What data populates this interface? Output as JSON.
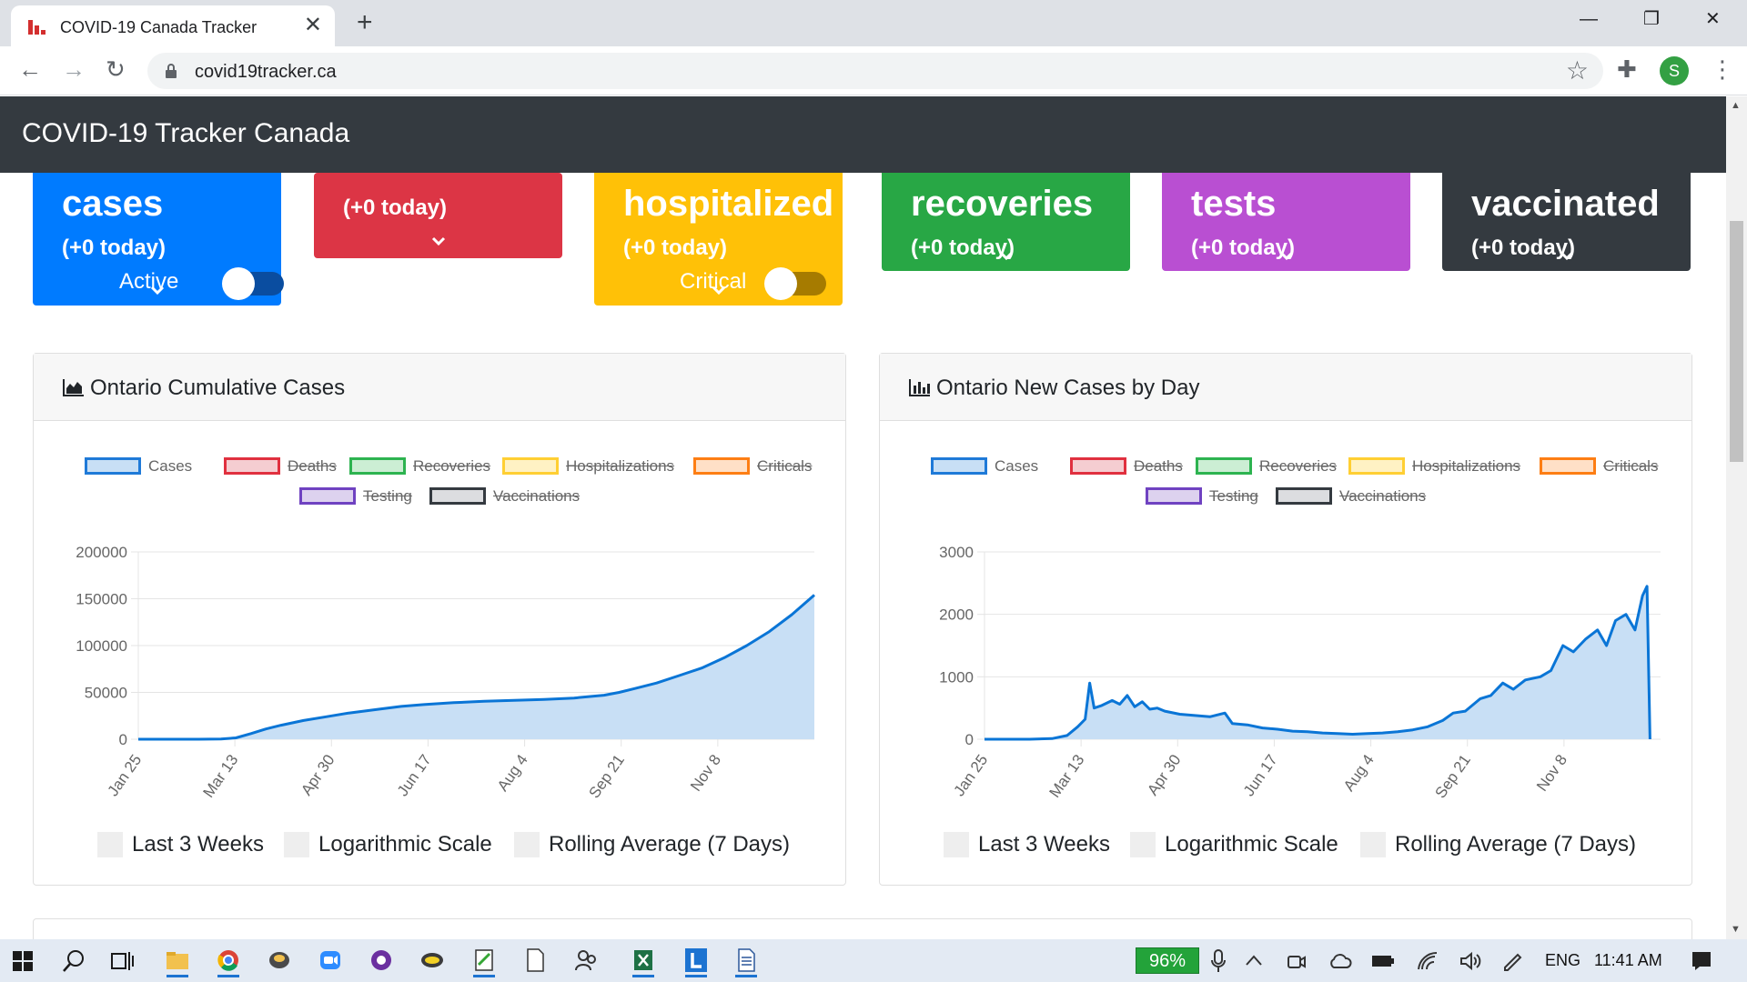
{
  "browser": {
    "tab_title": "COVID-19 Canada Tracker",
    "tab_close": "✕",
    "new_tab": "+",
    "url": "covid19tracker.ca",
    "profile_initial": "S",
    "window_controls": {
      "minimize": "—",
      "restore": "❐",
      "close": "✕"
    },
    "nav": {
      "back": "←",
      "forward": "→",
      "reload": "↻"
    },
    "toolbar_icons": {
      "star": "☆",
      "extensions": "✚",
      "menu": "⋮"
    }
  },
  "page": {
    "brand": "COVID-19 Tracker Canada",
    "stats": [
      {
        "key": "cases",
        "title": "cases",
        "today": "(+0 today)",
        "toggle_label": "Active",
        "color": "#007bff"
      },
      {
        "key": "deaths",
        "title": "",
        "today": "(+0 today)",
        "toggle_label": "",
        "color": "#dc3545"
      },
      {
        "key": "hospitalized",
        "title": "hospitalized",
        "today": "(+0 today)",
        "toggle_label": "Critical",
        "color": "#ffc107"
      },
      {
        "key": "recoveries",
        "title": "recoveries",
        "today": "(+0 today)",
        "toggle_label": "",
        "color": "#28a745"
      },
      {
        "key": "tests",
        "title": "tests",
        "today": "(+0 today)",
        "toggle_label": "",
        "color": "#b94fd2"
      },
      {
        "key": "vaccinated",
        "title": "vaccinated",
        "today": "(+0 today)",
        "toggle_label": "",
        "color": "#343a40"
      }
    ],
    "cards": [
      {
        "title": "Ontario Cumulative Cases",
        "options": [
          "Last 3 Weeks",
          "Logarithmic Scale",
          "Rolling Average (7 Days)"
        ]
      },
      {
        "title": "Ontario New Cases by Day",
        "options": [
          "Last 3 Weeks",
          "Logarithmic Scale",
          "Rolling Average (7 Days)"
        ]
      }
    ],
    "legend": [
      {
        "label": "Cases",
        "color": "#1f7ad8",
        "fill": "#c8dff5",
        "hidden": false
      },
      {
        "label": "Deaths",
        "color": "#e0303f",
        "fill": "#f5cdd1",
        "hidden": true
      },
      {
        "label": "Recoveries",
        "color": "#2db350",
        "fill": "#cceed4",
        "hidden": true
      },
      {
        "label": "Hospitalizations",
        "color": "#ffcf33",
        "fill": "#fff2c4",
        "hidden": true
      },
      {
        "label": "Criticals",
        "color": "#fd7e14",
        "fill": "#ffe0c7",
        "hidden": true
      },
      {
        "label": "Testing",
        "color": "#6f42c1",
        "fill": "#ddd2ef",
        "hidden": true
      },
      {
        "label": "Vaccinations",
        "color": "#343a40",
        "fill": "#dcdde0",
        "hidden": true
      }
    ]
  },
  "chart_data": [
    {
      "type": "area",
      "title": "Ontario Cumulative Cases",
      "series_name": "Cases",
      "x_ticks": [
        "Jan 25",
        "Mar 13",
        "Apr 30",
        "Jun 17",
        "Aug 4",
        "Sep 21",
        "Nov 8"
      ],
      "ylim": [
        0,
        200000
      ],
      "y_ticks": [
        "200000",
        "150000",
        "100000",
        "50000",
        "0"
      ],
      "y_tick_values": [
        200000,
        150000,
        100000,
        50000,
        0
      ],
      "color": "#0a75d6",
      "fill": "#c8dff5",
      "grid": true,
      "points": [
        [
          0,
          0
        ],
        [
          40,
          2
        ],
        [
          55,
          200
        ],
        [
          65,
          1500
        ],
        [
          75,
          6000
        ],
        [
          85,
          11000
        ],
        [
          95,
          15000
        ],
        [
          110,
          20000
        ],
        [
          125,
          24000
        ],
        [
          140,
          28000
        ],
        [
          160,
          32000
        ],
        [
          175,
          35000
        ],
        [
          190,
          37000
        ],
        [
          210,
          39000
        ],
        [
          230,
          40500
        ],
        [
          250,
          41500
        ],
        [
          270,
          42500
        ],
        [
          290,
          44000
        ],
        [
          300,
          45500
        ],
        [
          310,
          47000
        ],
        [
          320,
          50000
        ],
        [
          330,
          54000
        ],
        [
          345,
          60000
        ],
        [
          360,
          68000
        ],
        [
          375,
          76000
        ],
        [
          390,
          87000
        ],
        [
          405,
          100000
        ],
        [
          420,
          115000
        ],
        [
          435,
          133000
        ],
        [
          450,
          154000
        ]
      ]
    },
    {
      "type": "area",
      "title": "Ontario New Cases by Day",
      "series_name": "Cases",
      "x_ticks": [
        "Jan 25",
        "Mar 13",
        "Apr 30",
        "Jun 17",
        "Aug 4",
        "Sep 21",
        "Nov 8"
      ],
      "ylim": [
        0,
        3000
      ],
      "y_ticks": [
        "3000",
        "2000",
        "1000",
        "0"
      ],
      "y_tick_values": [
        3000,
        2000,
        1000,
        0
      ],
      "color": "#0a75d6",
      "fill": "#c8dff5",
      "grid": true,
      "points": [
        [
          0,
          0
        ],
        [
          30,
          0
        ],
        [
          45,
          10
        ],
        [
          55,
          60
        ],
        [
          62,
          200
        ],
        [
          67,
          320
        ],
        [
          70,
          900
        ],
        [
          73,
          500
        ],
        [
          78,
          540
        ],
        [
          85,
          620
        ],
        [
          90,
          560
        ],
        [
          95,
          700
        ],
        [
          100,
          520
        ],
        [
          105,
          600
        ],
        [
          110,
          480
        ],
        [
          115,
          500
        ],
        [
          120,
          450
        ],
        [
          130,
          400
        ],
        [
          140,
          380
        ],
        [
          150,
          360
        ],
        [
          160,
          420
        ],
        [
          165,
          250
        ],
        [
          175,
          230
        ],
        [
          185,
          180
        ],
        [
          195,
          160
        ],
        [
          205,
          130
        ],
        [
          215,
          120
        ],
        [
          225,
          100
        ],
        [
          235,
          90
        ],
        [
          245,
          80
        ],
        [
          255,
          90
        ],
        [
          265,
          100
        ],
        [
          275,
          120
        ],
        [
          285,
          150
        ],
        [
          295,
          200
        ],
        [
          305,
          300
        ],
        [
          312,
          420
        ],
        [
          320,
          450
        ],
        [
          330,
          650
        ],
        [
          337,
          700
        ],
        [
          345,
          900
        ],
        [
          352,
          800
        ],
        [
          360,
          950
        ],
        [
          370,
          1000
        ],
        [
          377,
          1100
        ],
        [
          385,
          1500
        ],
        [
          392,
          1400
        ],
        [
          400,
          1600
        ],
        [
          408,
          1750
        ],
        [
          414,
          1500
        ],
        [
          420,
          1900
        ],
        [
          427,
          2000
        ],
        [
          433,
          1750
        ],
        [
          438,
          2300
        ],
        [
          441,
          2450
        ],
        [
          443,
          0
        ]
      ]
    }
  ],
  "taskbar": {
    "zoom": "96%",
    "lang": "ENG",
    "time": "11:41 AM"
  }
}
